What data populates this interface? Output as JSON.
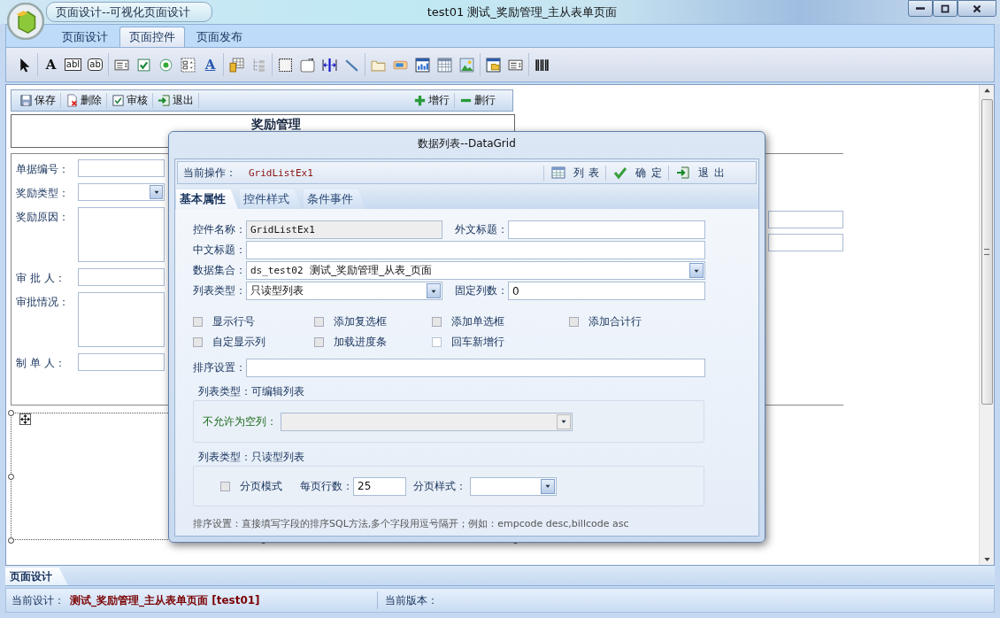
{
  "window": {
    "app_title": "页面设计--可视化页面设计",
    "title": "test01  测试_奖励管理_主从表单页面"
  },
  "ribbon_tabs": [
    {
      "label": "页面设计",
      "selected": false
    },
    {
      "label": "页面控件",
      "selected": true
    },
    {
      "label": "页面发布",
      "selected": false
    }
  ],
  "toolbar_tools": [
    {
      "kind": "pointer"
    },
    {
      "kind": "text",
      "glyph": "A"
    },
    {
      "kind": "textbox",
      "glyph": "abl"
    },
    {
      "kind": "button",
      "glyph": "ab"
    },
    {
      "kind": "combo"
    },
    {
      "kind": "checkbox"
    },
    {
      "kind": "radio"
    },
    {
      "kind": "listbox"
    },
    {
      "kind": "label",
      "glyph": "A"
    },
    {
      "kind": "grid"
    },
    {
      "kind": "tree"
    },
    {
      "kind": "frame"
    },
    {
      "kind": "memo"
    },
    {
      "kind": "split"
    },
    {
      "kind": "line"
    },
    {
      "kind": "folder"
    },
    {
      "kind": "progress"
    },
    {
      "kind": "chart"
    },
    {
      "kind": "calendar"
    },
    {
      "kind": "image"
    },
    {
      "kind": "window"
    },
    {
      "kind": "combo"
    },
    {
      "kind": "barcode"
    }
  ],
  "form": {
    "toolbar_left": [
      {
        "label": "保存",
        "kind": "save"
      },
      {
        "label": "删除",
        "kind": "delete"
      },
      {
        "label": "审核",
        "kind": "audit"
      },
      {
        "label": "退出",
        "kind": "exit"
      }
    ],
    "toolbar_right": [
      {
        "label": "增行",
        "kind": "plus"
      },
      {
        "label": "删行",
        "kind": "minus"
      }
    ],
    "title": "奖励管理",
    "fields": [
      {
        "label": "单据编号：",
        "kind": "text"
      },
      {
        "label": "奖励类型：",
        "kind": "select"
      },
      {
        "label": "奖励原因：",
        "kind": "textarea"
      },
      {
        "label": "审 批 人：",
        "kind": "text"
      },
      {
        "label": "审批情况：",
        "kind": "textarea"
      },
      {
        "label": "制 单 人：",
        "kind": "text"
      }
    ],
    "side_fields": [
      {
        "kind": "text"
      },
      {
        "kind": "text"
      }
    ]
  },
  "dialog": {
    "title": "数据列表--DataGrid",
    "operation_label": "当前操作：",
    "operation_value": "GridListEx1",
    "actions": [
      {
        "label": "列 表",
        "kind": "table"
      },
      {
        "label": "确 定",
        "kind": "check"
      },
      {
        "label": "退 出",
        "kind": "exit"
      }
    ],
    "tabs": [
      {
        "label": "基本属性",
        "selected": true
      },
      {
        "label": "控件样式",
        "selected": false
      },
      {
        "label": "条件事件",
        "selected": false
      }
    ],
    "fields": [
      {
        "label": "控件名称：",
        "kind": "text",
        "value": "GridListEx1",
        "disabled": true
      },
      {
        "label": "外文标题：",
        "kind": "text",
        "disabled": false
      },
      {
        "label": "中文标题：",
        "kind": "text",
        "disabled": false
      },
      {
        "label": "数据集合：",
        "kind": "select",
        "value": "ds_test02  测试_奖励管理_从表_页面",
        "disabled": false
      },
      {
        "label": "列表类型：",
        "kind": "select",
        "value": "只读型列表",
        "disabled": false
      },
      {
        "label": "固定列数：",
        "kind": "text",
        "value": "0",
        "disabled": false
      }
    ],
    "options": [
      {
        "label": "显示行号",
        "checked": false,
        "disabled": true
      },
      {
        "label": "添加复选框",
        "checked": false,
        "disabled": true
      },
      {
        "label": "添加单选框",
        "checked": false,
        "disabled": true
      },
      {
        "label": "添加合计行",
        "checked": false,
        "disabled": true
      },
      {
        "label": "自定显示列",
        "checked": false,
        "disabled": true
      },
      {
        "label": "加载进度条",
        "checked": false,
        "disabled": true
      },
      {
        "label": "回车新增行",
        "checked": false,
        "disabled": false
      }
    ],
    "sort_label": "排序设置：",
    "editable_group": {
      "title": "列表类型：可编辑列表",
      "label": "不允许为空列：",
      "disabled": true
    },
    "readonly_group": {
      "title": "列表类型：只读型列表",
      "paging": {
        "label": "分页模式",
        "checked": false,
        "disabled": true
      },
      "rows_label": "每页行数：",
      "rows_value": "25",
      "style_label": "分页样式："
    },
    "hint": "排序设置：直接填写字段的排序SQL方法,多个字段用逗号隔开；例如：empcode desc,billcode asc"
  },
  "bottom_tabs": [
    {
      "label": "页面设计",
      "selected": true
    }
  ],
  "status_bar": {
    "design_label": "当前设计：",
    "design_value": "测试_奖励管理_主从表单页面 [test01]",
    "version_label": "当前版本："
  }
}
